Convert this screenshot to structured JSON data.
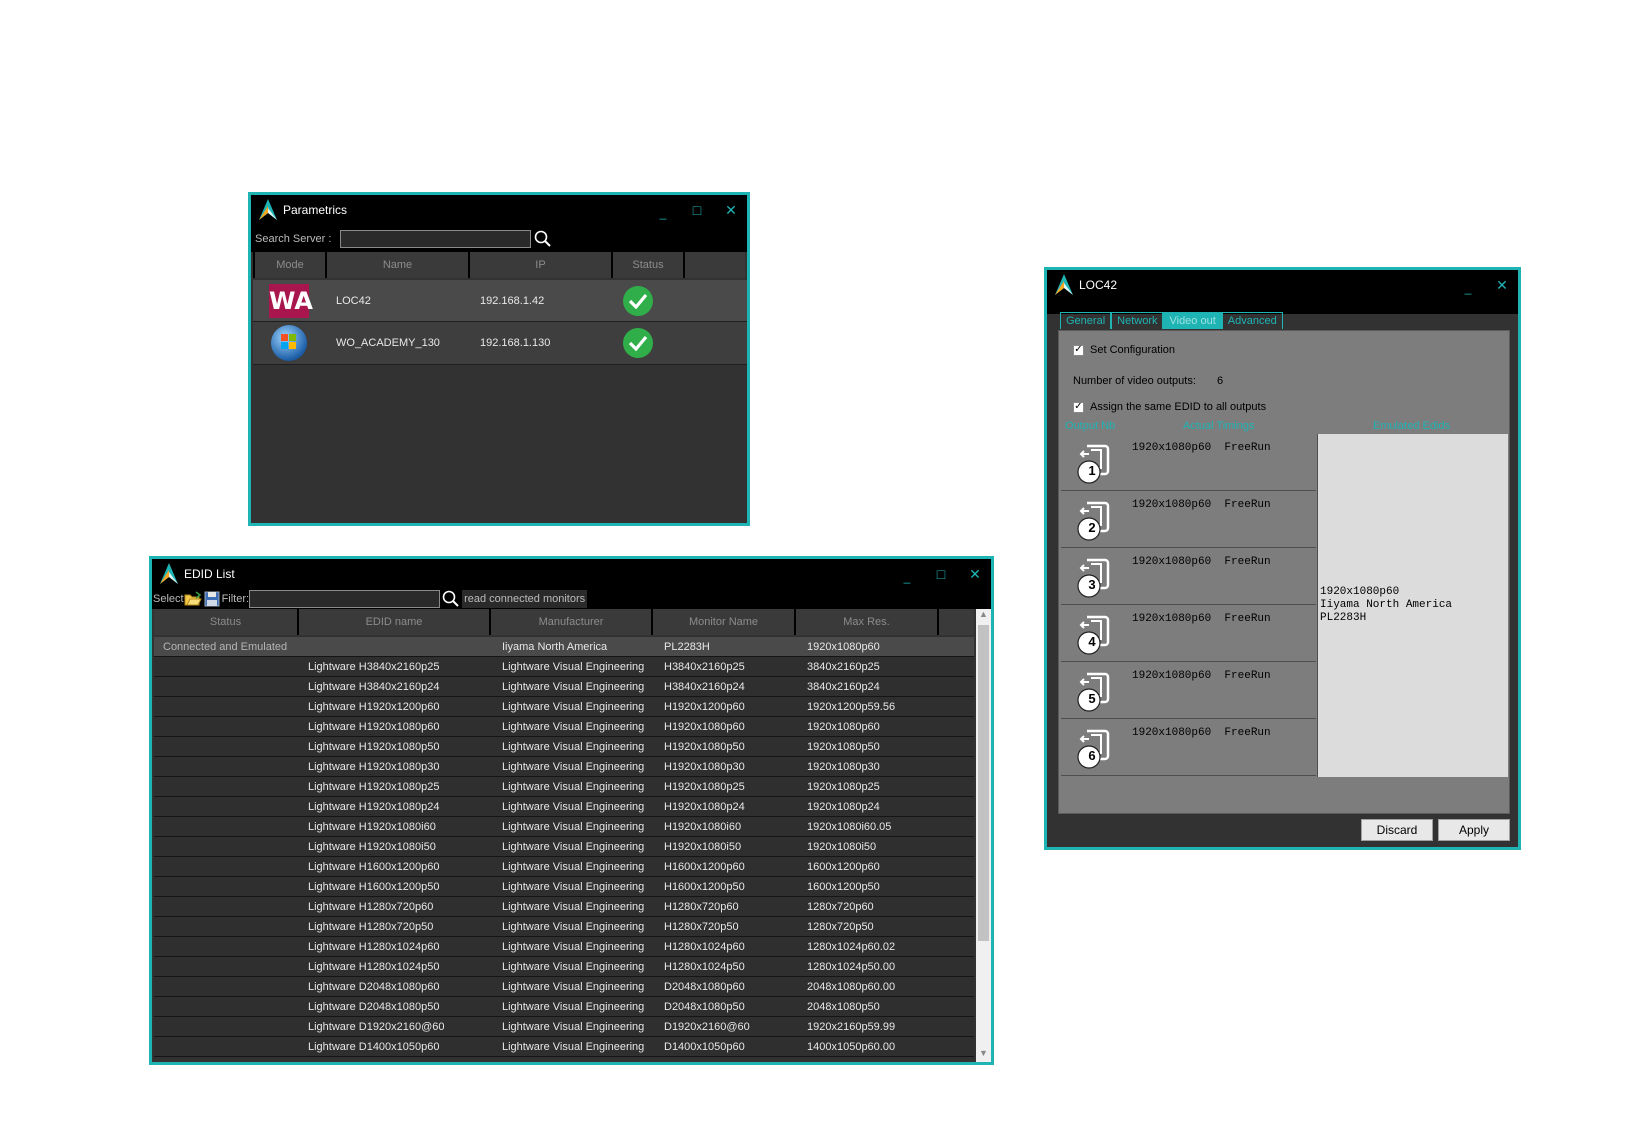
{
  "parametrics": {
    "title": "Parametrics",
    "search_label": "Search Server :",
    "search_value": "",
    "columns": [
      "Mode",
      "Name",
      "IP",
      "Status"
    ],
    "rows": [
      {
        "mode": "WA",
        "mode_icon": "wa-logo-icon",
        "name": "LOC42",
        "ip": "192.168.1.42",
        "status_icon": "check-icon"
      },
      {
        "mode": "",
        "mode_icon": "windows-logo-icon",
        "name": "WO_ACADEMY_130",
        "ip": "192.168.1.130",
        "status_icon": "check-icon"
      }
    ]
  },
  "window_controls": {
    "minimize": "_",
    "maximize": "□",
    "close": "✕"
  },
  "edid_list": {
    "title": "EDID List",
    "select_label": "Select",
    "filter_label": "Filter:",
    "filter_value": "",
    "read_label": "read connected monitors",
    "columns": [
      "Status",
      "EDID name",
      "Manufacturer",
      "Monitor Name",
      "Max Res."
    ],
    "rows": [
      [
        "Connected and Emulated",
        "",
        "Iiyama North America",
        "PL2283H",
        "1920x1080p60"
      ],
      [
        "",
        "Lightware H3840x2160p25",
        "Lightware Visual Engineering",
        "H3840x2160p25",
        "3840x2160p25"
      ],
      [
        "",
        "Lightware H3840x2160p24",
        "Lightware Visual Engineering",
        "H3840x2160p24",
        "3840x2160p24"
      ],
      [
        "",
        "Lightware H1920x1200p60",
        "Lightware Visual Engineering",
        "H1920x1200p60",
        "1920x1200p59.56"
      ],
      [
        "",
        "Lightware H1920x1080p60",
        "Lightware Visual Engineering",
        "H1920x1080p60",
        "1920x1080p60"
      ],
      [
        "",
        "Lightware H1920x1080p50",
        "Lightware Visual Engineering",
        "H1920x1080p50",
        "1920x1080p50"
      ],
      [
        "",
        "Lightware H1920x1080p30",
        "Lightware Visual Engineering",
        "H1920x1080p30",
        "1920x1080p30"
      ],
      [
        "",
        "Lightware H1920x1080p25",
        "Lightware Visual Engineering",
        "H1920x1080p25",
        "1920x1080p25"
      ],
      [
        "",
        "Lightware H1920x1080p24",
        "Lightware Visual Engineering",
        "H1920x1080p24",
        "1920x1080p24"
      ],
      [
        "",
        "Lightware H1920x1080i60",
        "Lightware Visual Engineering",
        "H1920x1080i60",
        "1920x1080i60.05"
      ],
      [
        "",
        "Lightware H1920x1080i50",
        "Lightware Visual Engineering",
        "H1920x1080i50",
        "1920x1080i50"
      ],
      [
        "",
        "Lightware H1600x1200p60",
        "Lightware Visual Engineering",
        "H1600x1200p60",
        "1600x1200p60"
      ],
      [
        "",
        "Lightware H1600x1200p50",
        "Lightware Visual Engineering",
        "H1600x1200p50",
        "1600x1200p50"
      ],
      [
        "",
        "Lightware H1280x720p60",
        "Lightware Visual Engineering",
        "H1280x720p60",
        "1280x720p60"
      ],
      [
        "",
        "Lightware H1280x720p50",
        "Lightware Visual Engineering",
        "H1280x720p50",
        "1280x720p50"
      ],
      [
        "",
        "Lightware H1280x1024p60",
        "Lightware Visual Engineering",
        "H1280x1024p60",
        "1280x1024p60.02"
      ],
      [
        "",
        "Lightware H1280x1024p50",
        "Lightware Visual Engineering",
        "H1280x1024p50",
        "1280x1024p50.00"
      ],
      [
        "",
        "Lightware D2048x1080p60",
        "Lightware Visual Engineering",
        "D2048x1080p60",
        "2048x1080p60.00"
      ],
      [
        "",
        "Lightware D2048x1080p50",
        "Lightware Visual Engineering",
        "D2048x1080p50",
        "2048x1080p50"
      ],
      [
        "",
        "Lightware D1920x2160@60",
        "Lightware Visual Engineering",
        "D1920x2160@60",
        "1920x2160p59.99"
      ],
      [
        "",
        "Lightware D1400x1050p60",
        "Lightware Visual Engineering",
        "D1400x1050p60",
        "1400x1050p60.00"
      ]
    ]
  },
  "loc42": {
    "title": "LOC42",
    "tabs": [
      "General",
      "Network",
      "Video out",
      "Advanced"
    ],
    "active_tab": 2,
    "set_configuration": {
      "label": "Set Configuration",
      "checked": true
    },
    "num_outputs_label": "Number of video outputs:",
    "num_outputs_value": "6",
    "assign_same": {
      "label": "Assign the same EDID to all outputs",
      "checked": true
    },
    "col_headers": [
      "Output Nb",
      "Actual Timings",
      "Emulated Edids"
    ],
    "outputs": [
      {
        "number": "1",
        "timing": "1920x1080p60  FreeRun"
      },
      {
        "number": "2",
        "timing": "1920x1080p60  FreeRun"
      },
      {
        "number": "3",
        "timing": "1920x1080p60  FreeRun"
      },
      {
        "number": "4",
        "timing": "1920x1080p60  FreeRun"
      },
      {
        "number": "5",
        "timing": "1920x1080p60  FreeRun"
      },
      {
        "number": "6",
        "timing": "1920x1080p60  FreeRun"
      }
    ],
    "emulated_edid": [
      "1920x1080p60",
      "Iiyama North America",
      "PL2283H"
    ],
    "discard_label": "Discard",
    "apply_label": "Apply"
  }
}
